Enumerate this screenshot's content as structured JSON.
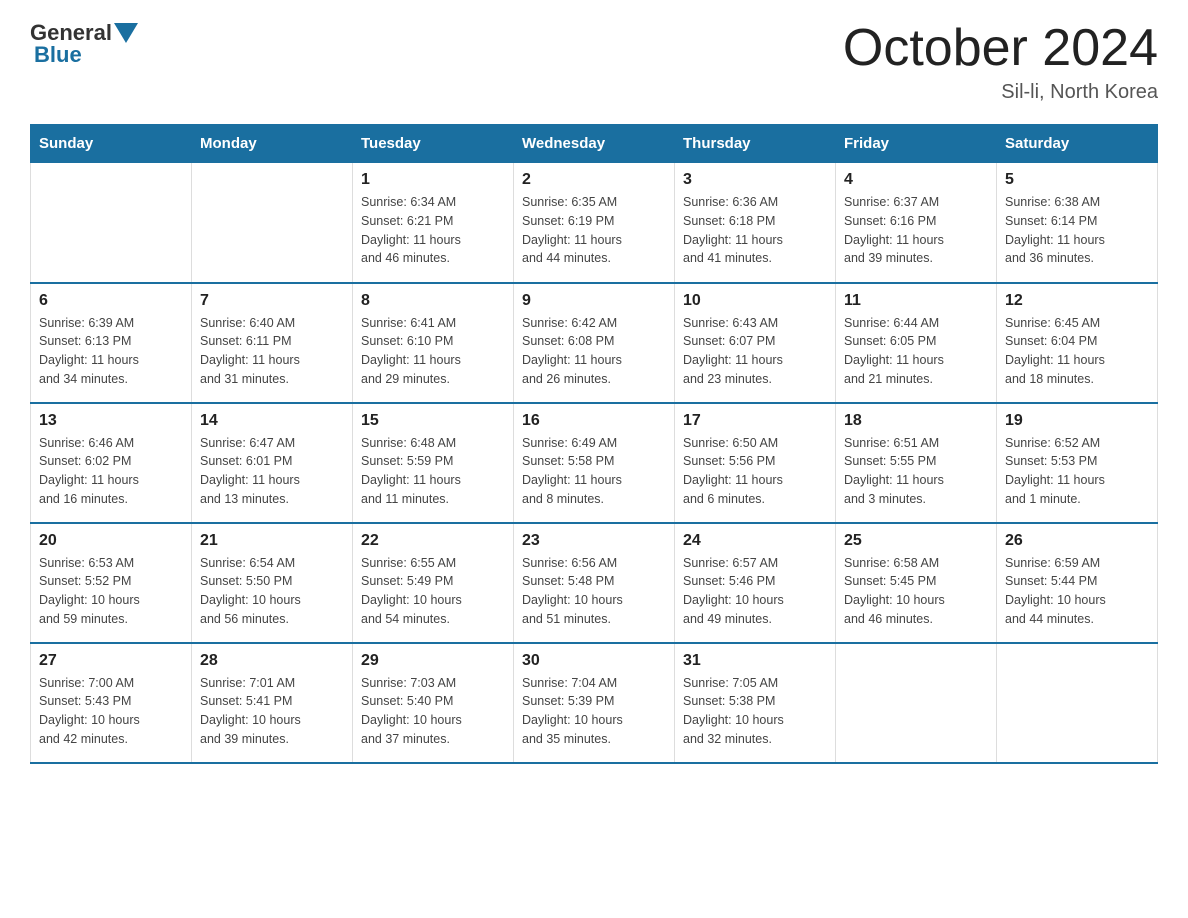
{
  "header": {
    "logo_general": "General",
    "logo_blue": "Blue",
    "title": "October 2024",
    "subtitle": "Sil-li, North Korea"
  },
  "weekdays": [
    "Sunday",
    "Monday",
    "Tuesday",
    "Wednesday",
    "Thursday",
    "Friday",
    "Saturday"
  ],
  "weeks": [
    [
      {
        "day": "",
        "info": ""
      },
      {
        "day": "",
        "info": ""
      },
      {
        "day": "1",
        "info": "Sunrise: 6:34 AM\nSunset: 6:21 PM\nDaylight: 11 hours\nand 46 minutes."
      },
      {
        "day": "2",
        "info": "Sunrise: 6:35 AM\nSunset: 6:19 PM\nDaylight: 11 hours\nand 44 minutes."
      },
      {
        "day": "3",
        "info": "Sunrise: 6:36 AM\nSunset: 6:18 PM\nDaylight: 11 hours\nand 41 minutes."
      },
      {
        "day": "4",
        "info": "Sunrise: 6:37 AM\nSunset: 6:16 PM\nDaylight: 11 hours\nand 39 minutes."
      },
      {
        "day": "5",
        "info": "Sunrise: 6:38 AM\nSunset: 6:14 PM\nDaylight: 11 hours\nand 36 minutes."
      }
    ],
    [
      {
        "day": "6",
        "info": "Sunrise: 6:39 AM\nSunset: 6:13 PM\nDaylight: 11 hours\nand 34 minutes."
      },
      {
        "day": "7",
        "info": "Sunrise: 6:40 AM\nSunset: 6:11 PM\nDaylight: 11 hours\nand 31 minutes."
      },
      {
        "day": "8",
        "info": "Sunrise: 6:41 AM\nSunset: 6:10 PM\nDaylight: 11 hours\nand 29 minutes."
      },
      {
        "day": "9",
        "info": "Sunrise: 6:42 AM\nSunset: 6:08 PM\nDaylight: 11 hours\nand 26 minutes."
      },
      {
        "day": "10",
        "info": "Sunrise: 6:43 AM\nSunset: 6:07 PM\nDaylight: 11 hours\nand 23 minutes."
      },
      {
        "day": "11",
        "info": "Sunrise: 6:44 AM\nSunset: 6:05 PM\nDaylight: 11 hours\nand 21 minutes."
      },
      {
        "day": "12",
        "info": "Sunrise: 6:45 AM\nSunset: 6:04 PM\nDaylight: 11 hours\nand 18 minutes."
      }
    ],
    [
      {
        "day": "13",
        "info": "Sunrise: 6:46 AM\nSunset: 6:02 PM\nDaylight: 11 hours\nand 16 minutes."
      },
      {
        "day": "14",
        "info": "Sunrise: 6:47 AM\nSunset: 6:01 PM\nDaylight: 11 hours\nand 13 minutes."
      },
      {
        "day": "15",
        "info": "Sunrise: 6:48 AM\nSunset: 5:59 PM\nDaylight: 11 hours\nand 11 minutes."
      },
      {
        "day": "16",
        "info": "Sunrise: 6:49 AM\nSunset: 5:58 PM\nDaylight: 11 hours\nand 8 minutes."
      },
      {
        "day": "17",
        "info": "Sunrise: 6:50 AM\nSunset: 5:56 PM\nDaylight: 11 hours\nand 6 minutes."
      },
      {
        "day": "18",
        "info": "Sunrise: 6:51 AM\nSunset: 5:55 PM\nDaylight: 11 hours\nand 3 minutes."
      },
      {
        "day": "19",
        "info": "Sunrise: 6:52 AM\nSunset: 5:53 PM\nDaylight: 11 hours\nand 1 minute."
      }
    ],
    [
      {
        "day": "20",
        "info": "Sunrise: 6:53 AM\nSunset: 5:52 PM\nDaylight: 10 hours\nand 59 minutes."
      },
      {
        "day": "21",
        "info": "Sunrise: 6:54 AM\nSunset: 5:50 PM\nDaylight: 10 hours\nand 56 minutes."
      },
      {
        "day": "22",
        "info": "Sunrise: 6:55 AM\nSunset: 5:49 PM\nDaylight: 10 hours\nand 54 minutes."
      },
      {
        "day": "23",
        "info": "Sunrise: 6:56 AM\nSunset: 5:48 PM\nDaylight: 10 hours\nand 51 minutes."
      },
      {
        "day": "24",
        "info": "Sunrise: 6:57 AM\nSunset: 5:46 PM\nDaylight: 10 hours\nand 49 minutes."
      },
      {
        "day": "25",
        "info": "Sunrise: 6:58 AM\nSunset: 5:45 PM\nDaylight: 10 hours\nand 46 minutes."
      },
      {
        "day": "26",
        "info": "Sunrise: 6:59 AM\nSunset: 5:44 PM\nDaylight: 10 hours\nand 44 minutes."
      }
    ],
    [
      {
        "day": "27",
        "info": "Sunrise: 7:00 AM\nSunset: 5:43 PM\nDaylight: 10 hours\nand 42 minutes."
      },
      {
        "day": "28",
        "info": "Sunrise: 7:01 AM\nSunset: 5:41 PM\nDaylight: 10 hours\nand 39 minutes."
      },
      {
        "day": "29",
        "info": "Sunrise: 7:03 AM\nSunset: 5:40 PM\nDaylight: 10 hours\nand 37 minutes."
      },
      {
        "day": "30",
        "info": "Sunrise: 7:04 AM\nSunset: 5:39 PM\nDaylight: 10 hours\nand 35 minutes."
      },
      {
        "day": "31",
        "info": "Sunrise: 7:05 AM\nSunset: 5:38 PM\nDaylight: 10 hours\nand 32 minutes."
      },
      {
        "day": "",
        "info": ""
      },
      {
        "day": "",
        "info": ""
      }
    ]
  ]
}
